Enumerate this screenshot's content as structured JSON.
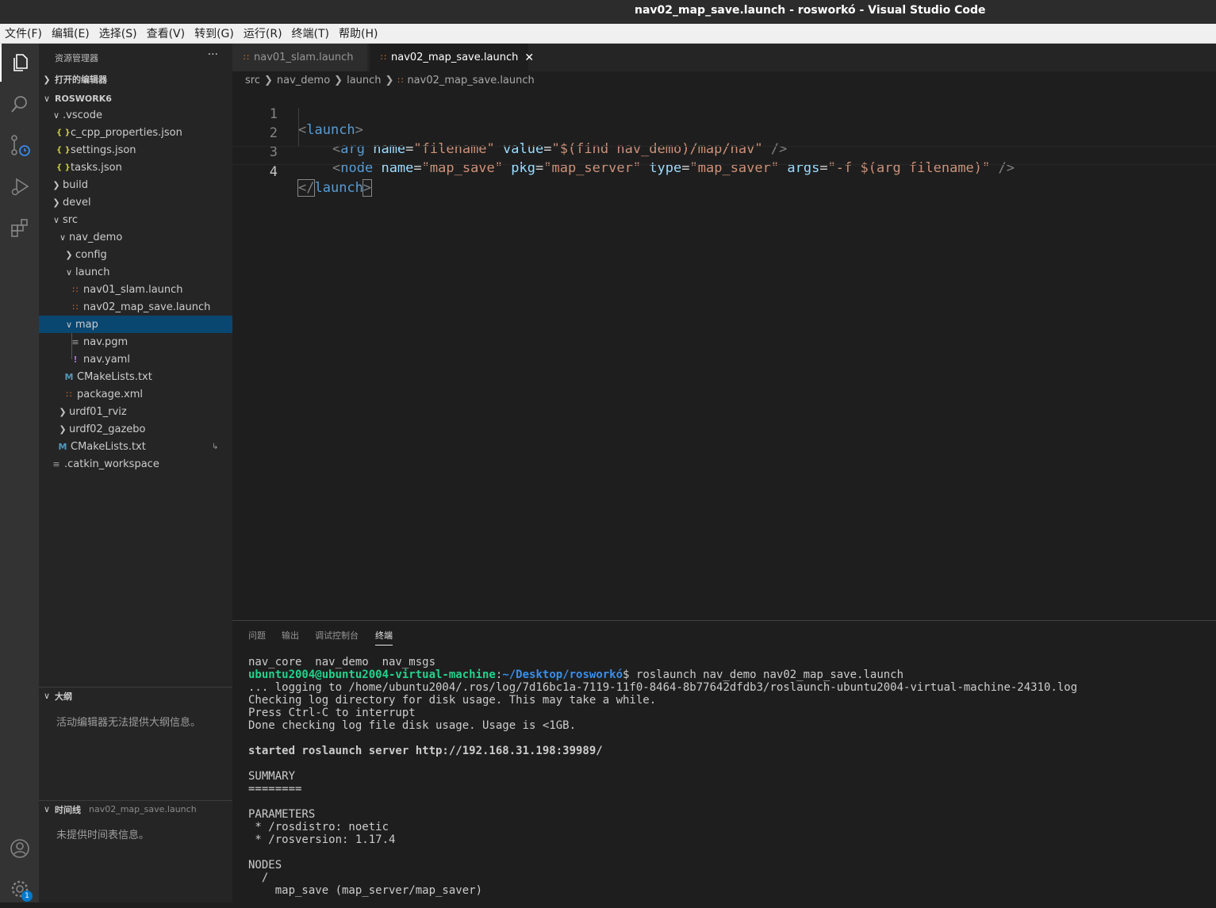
{
  "window": {
    "title": "nav02_map_save.launch - rosworkó - Visual Studio Code"
  },
  "menu": [
    "文件(F)",
    "编辑(E)",
    "选择(S)",
    "查看(V)",
    "转到(G)",
    "运行(R)",
    "终端(T)",
    "帮助(H)"
  ],
  "activity_bar": {
    "items": [
      "explorer-icon",
      "search-icon",
      "source-control-icon",
      "run-debug-icon",
      "extensions-icon"
    ],
    "bottom": [
      "account-icon",
      "gear-icon"
    ],
    "settings_badge": "1"
  },
  "sidebar": {
    "title": "资源管理器",
    "more": "···",
    "open_editors": "打开的编辑器",
    "workspace": "ROSWORK6",
    "tree": [
      {
        "label": ".vscode",
        "type": "folder-open"
      },
      {
        "label": "c_cpp_properties.json",
        "type": "json"
      },
      {
        "label": "settings.json",
        "type": "json"
      },
      {
        "label": "tasks.json",
        "type": "json"
      },
      {
        "label": "build",
        "type": "folder"
      },
      {
        "label": "devel",
        "type": "folder"
      },
      {
        "label": "src",
        "type": "folder-open"
      },
      {
        "label": "nav_demo",
        "type": "folder-open"
      },
      {
        "label": "config",
        "type": "folder"
      },
      {
        "label": "launch",
        "type": "folder-open"
      },
      {
        "label": "nav01_slam.launch",
        "type": "rss"
      },
      {
        "label": "nav02_map_save.launch",
        "type": "rss"
      },
      {
        "label": "map",
        "type": "folder-open"
      },
      {
        "label": "nav.pgm",
        "type": "lines"
      },
      {
        "label": "nav.yaml",
        "type": "yaml"
      },
      {
        "label": "CMakeLists.txt",
        "type": "m"
      },
      {
        "label": "package.xml",
        "type": "rss"
      },
      {
        "label": "urdf01_rviz",
        "type": "folder"
      },
      {
        "label": "urdf02_gazebo",
        "type": "folder"
      },
      {
        "label": "CMakeLists.txt",
        "type": "m"
      },
      {
        "label": ".catkin_workspace",
        "type": "lines"
      }
    ],
    "outline": {
      "title": "大纲",
      "message": "活动编辑器无法提供大纲信息。"
    },
    "timeline": {
      "title": "时间线",
      "file": "nav02_map_save.launch",
      "message": "未提供时间表信息。"
    }
  },
  "tabs": [
    {
      "label": "nav01_slam.launch",
      "active": false
    },
    {
      "label": "nav02_map_save.launch",
      "active": true
    }
  ],
  "breadcrumb": [
    "src",
    "nav_demo",
    "launch",
    "nav02_map_save.launch"
  ],
  "editor": {
    "line_numbers": [
      "1",
      "2",
      "3",
      "4"
    ],
    "tokens": {
      "lt": "<",
      "gt": ">",
      "selfclose": " />",
      "endopen": "</",
      "launch": "launch",
      "arg": "arg",
      "node": "node",
      "name": "name",
      "value": "value",
      "pkg": "pkg",
      "type": "type",
      "args": "args",
      "eq": "=",
      "s_filename": "\"filename\"",
      "s_value": "\"$(find nav_demo)/map/nav\"",
      "s_map_save": "\"map_save\"",
      "s_map_server": "\"map_server\"",
      "s_map_saver": "\"map_saver\"",
      "s_args": "\"-f $(arg filename)\""
    }
  },
  "panel": {
    "tabs": [
      "问题",
      "输出",
      "调试控制台",
      "终端"
    ],
    "active_tab": "终端",
    "terminal": {
      "line0": "nav_core  nav_demo  nav_msgs",
      "prompt_user": "ubuntu2004@ubuntu2004-virtual-machine",
      "prompt_colon": ":",
      "prompt_path": "~/Desktop/rosworkó",
      "prompt_cmd": "$ roslaunch nav_demo nav02_map_save.launch",
      "lines": [
        "... logging to /home/ubuntu2004/.ros/log/7d16bc1a-7119-11f0-8464-8b77642dfdb3/roslaunch-ubuntu2004-virtual-machine-24310.log",
        "Checking log directory for disk usage. This may take a while.",
        "Press Ctrl-C to interrupt",
        "Done checking log file disk usage. Usage is <1GB."
      ],
      "server_line": "started roslaunch server http://192.168.31.198:39989/",
      "summary": [
        "SUMMARY",
        "========"
      ],
      "parameters": [
        "PARAMETERS",
        " * /rosdistro: noetic",
        " * /rosversion: 1.17.4"
      ],
      "nodes": [
        "NODES",
        "  /",
        "    map_save (map_server/map_saver)"
      ]
    }
  }
}
